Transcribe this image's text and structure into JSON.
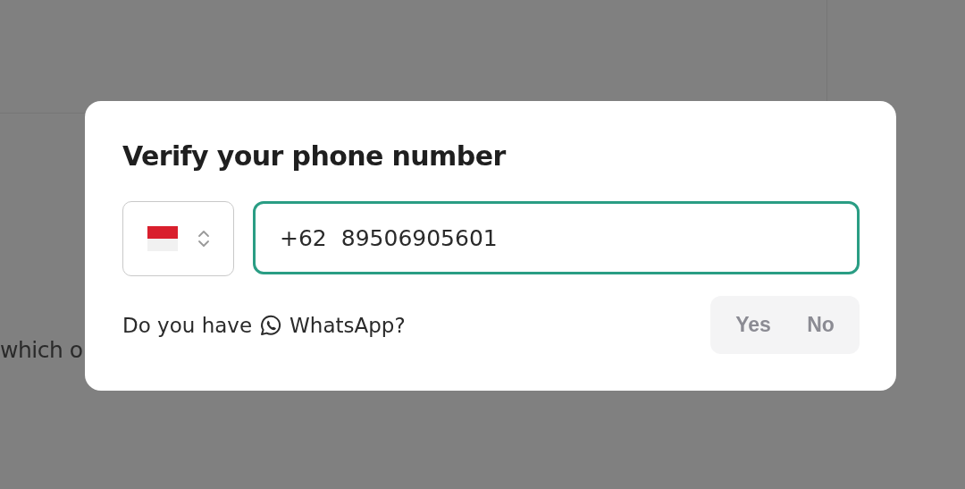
{
  "background": {
    "text": "which o"
  },
  "dialog": {
    "title": "Verify your phone number",
    "country_select": {
      "kind": "flag-two-band"
    },
    "phone_field": {
      "dial_code": "+62",
      "value": "89506905601",
      "focused": true
    },
    "question": {
      "prefix": "Do you have",
      "app": "WhatsApp?"
    },
    "options": [
      {
        "label": "Yes",
        "selected": false
      },
      {
        "label": "No",
        "selected": false
      }
    ]
  }
}
